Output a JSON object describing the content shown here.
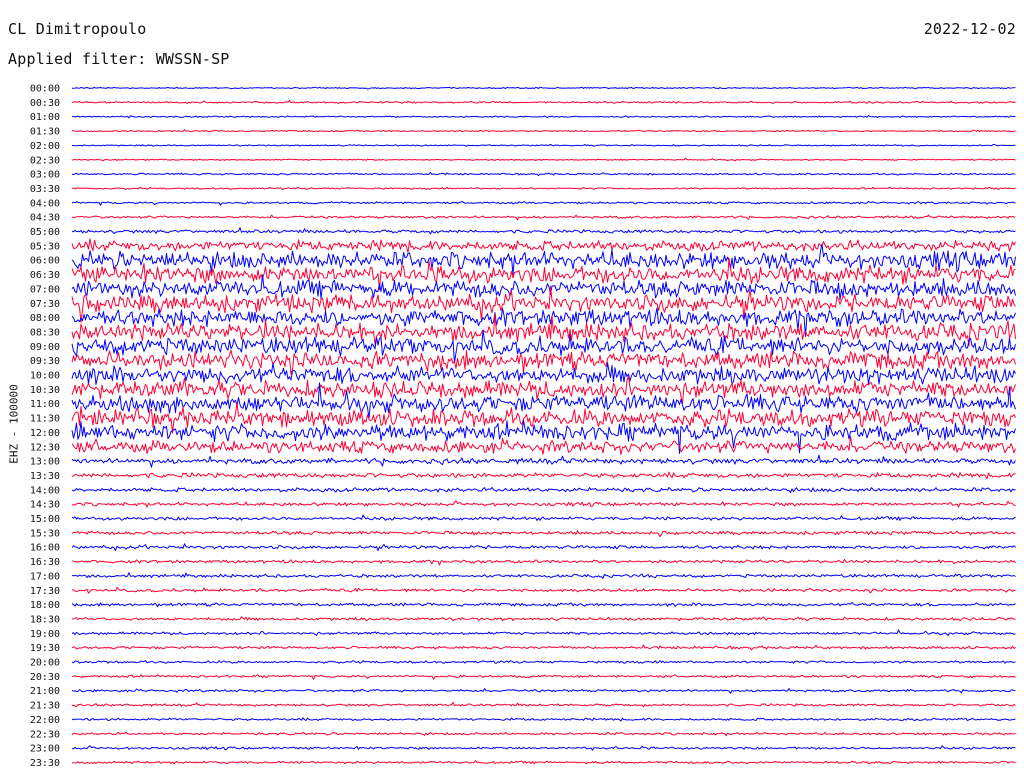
{
  "header": {
    "station": "CL Dimitropoulo",
    "filter": "Applied filter: WWSSN-SP",
    "date": "2022-12-02"
  },
  "colors": {
    "blue": "#0000ff",
    "red": "#ff0033",
    "background": "#ffffff"
  },
  "chart_data": {
    "type": "line",
    "title": "",
    "ylabel": "EHZ - 100000",
    "xlabel": "",
    "grid": false,
    "legend": "none",
    "y_ticks": [
      "00:00",
      "00:30",
      "01:00",
      "01:30",
      "02:00",
      "02:30",
      "03:00",
      "03:30",
      "04:00",
      "04:30",
      "05:00",
      "05:30",
      "06:00",
      "06:30",
      "07:00",
      "07:30",
      "08:00",
      "08:30",
      "09:00",
      "09:30",
      "10:00",
      "10:30",
      "11:00",
      "11:30",
      "12:00",
      "12:30",
      "13:00",
      "13:30",
      "14:00",
      "14:30",
      "15:00",
      "15:30",
      "16:00",
      "16:30",
      "17:00",
      "17:30",
      "18:00",
      "18:30",
      "19:00",
      "19:30",
      "20:00",
      "20:30",
      "21:00",
      "21:30",
      "22:00",
      "22:30",
      "23:00",
      "23:30"
    ],
    "trace_color_order": [
      "blue",
      "red"
    ],
    "trace_relative_amplitude": [
      0.4,
      0.5,
      0.4,
      0.4,
      0.4,
      0.4,
      0.5,
      0.5,
      0.6,
      0.7,
      1.0,
      3.0,
      5.0,
      5.0,
      5.0,
      5.0,
      5.0,
      5.0,
      5.0,
      5.0,
      5.0,
      5.0,
      5.0,
      5.0,
      5.0,
      3.5,
      1.6,
      1.4,
      1.2,
      1.0,
      1.0,
      1.0,
      1.0,
      0.9,
      0.9,
      0.9,
      0.9,
      0.9,
      0.8,
      0.8,
      0.7,
      0.7,
      0.7,
      0.7,
      0.7,
      0.7,
      0.7,
      0.7
    ]
  }
}
